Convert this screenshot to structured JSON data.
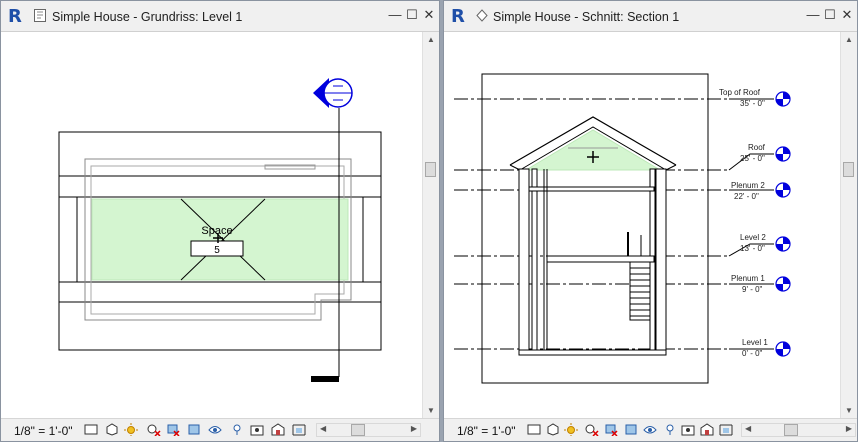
{
  "left_window": {
    "title": "Simple House - Grundriss: Level 1",
    "scale": "1/8\" = 1'-0\"",
    "space_label": "Space",
    "space_number": "5"
  },
  "right_window": {
    "title": "Simple House - Schnitt: Section 1",
    "scale": "1/8\" = 1'-0\"",
    "levels": [
      {
        "name": "Top of Roof",
        "elevation": "35' - 0\""
      },
      {
        "name": "Roof",
        "elevation": "25' - 0\""
      },
      {
        "name": "Plenum 2",
        "elevation": "22' - 0\""
      },
      {
        "name": "Level 2",
        "elevation": "13' - 0\""
      },
      {
        "name": "Plenum 1",
        "elevation": "9' - 0\""
      },
      {
        "name": "Level 1",
        "elevation": "0' - 0\""
      }
    ]
  },
  "controls": {
    "minimize": "—",
    "maximize": "☐",
    "close": "✕"
  },
  "colors": {
    "space_fill": "#d4f5d0",
    "revit_blue": "#1f4fa8",
    "section_marker": "#0000dd"
  }
}
